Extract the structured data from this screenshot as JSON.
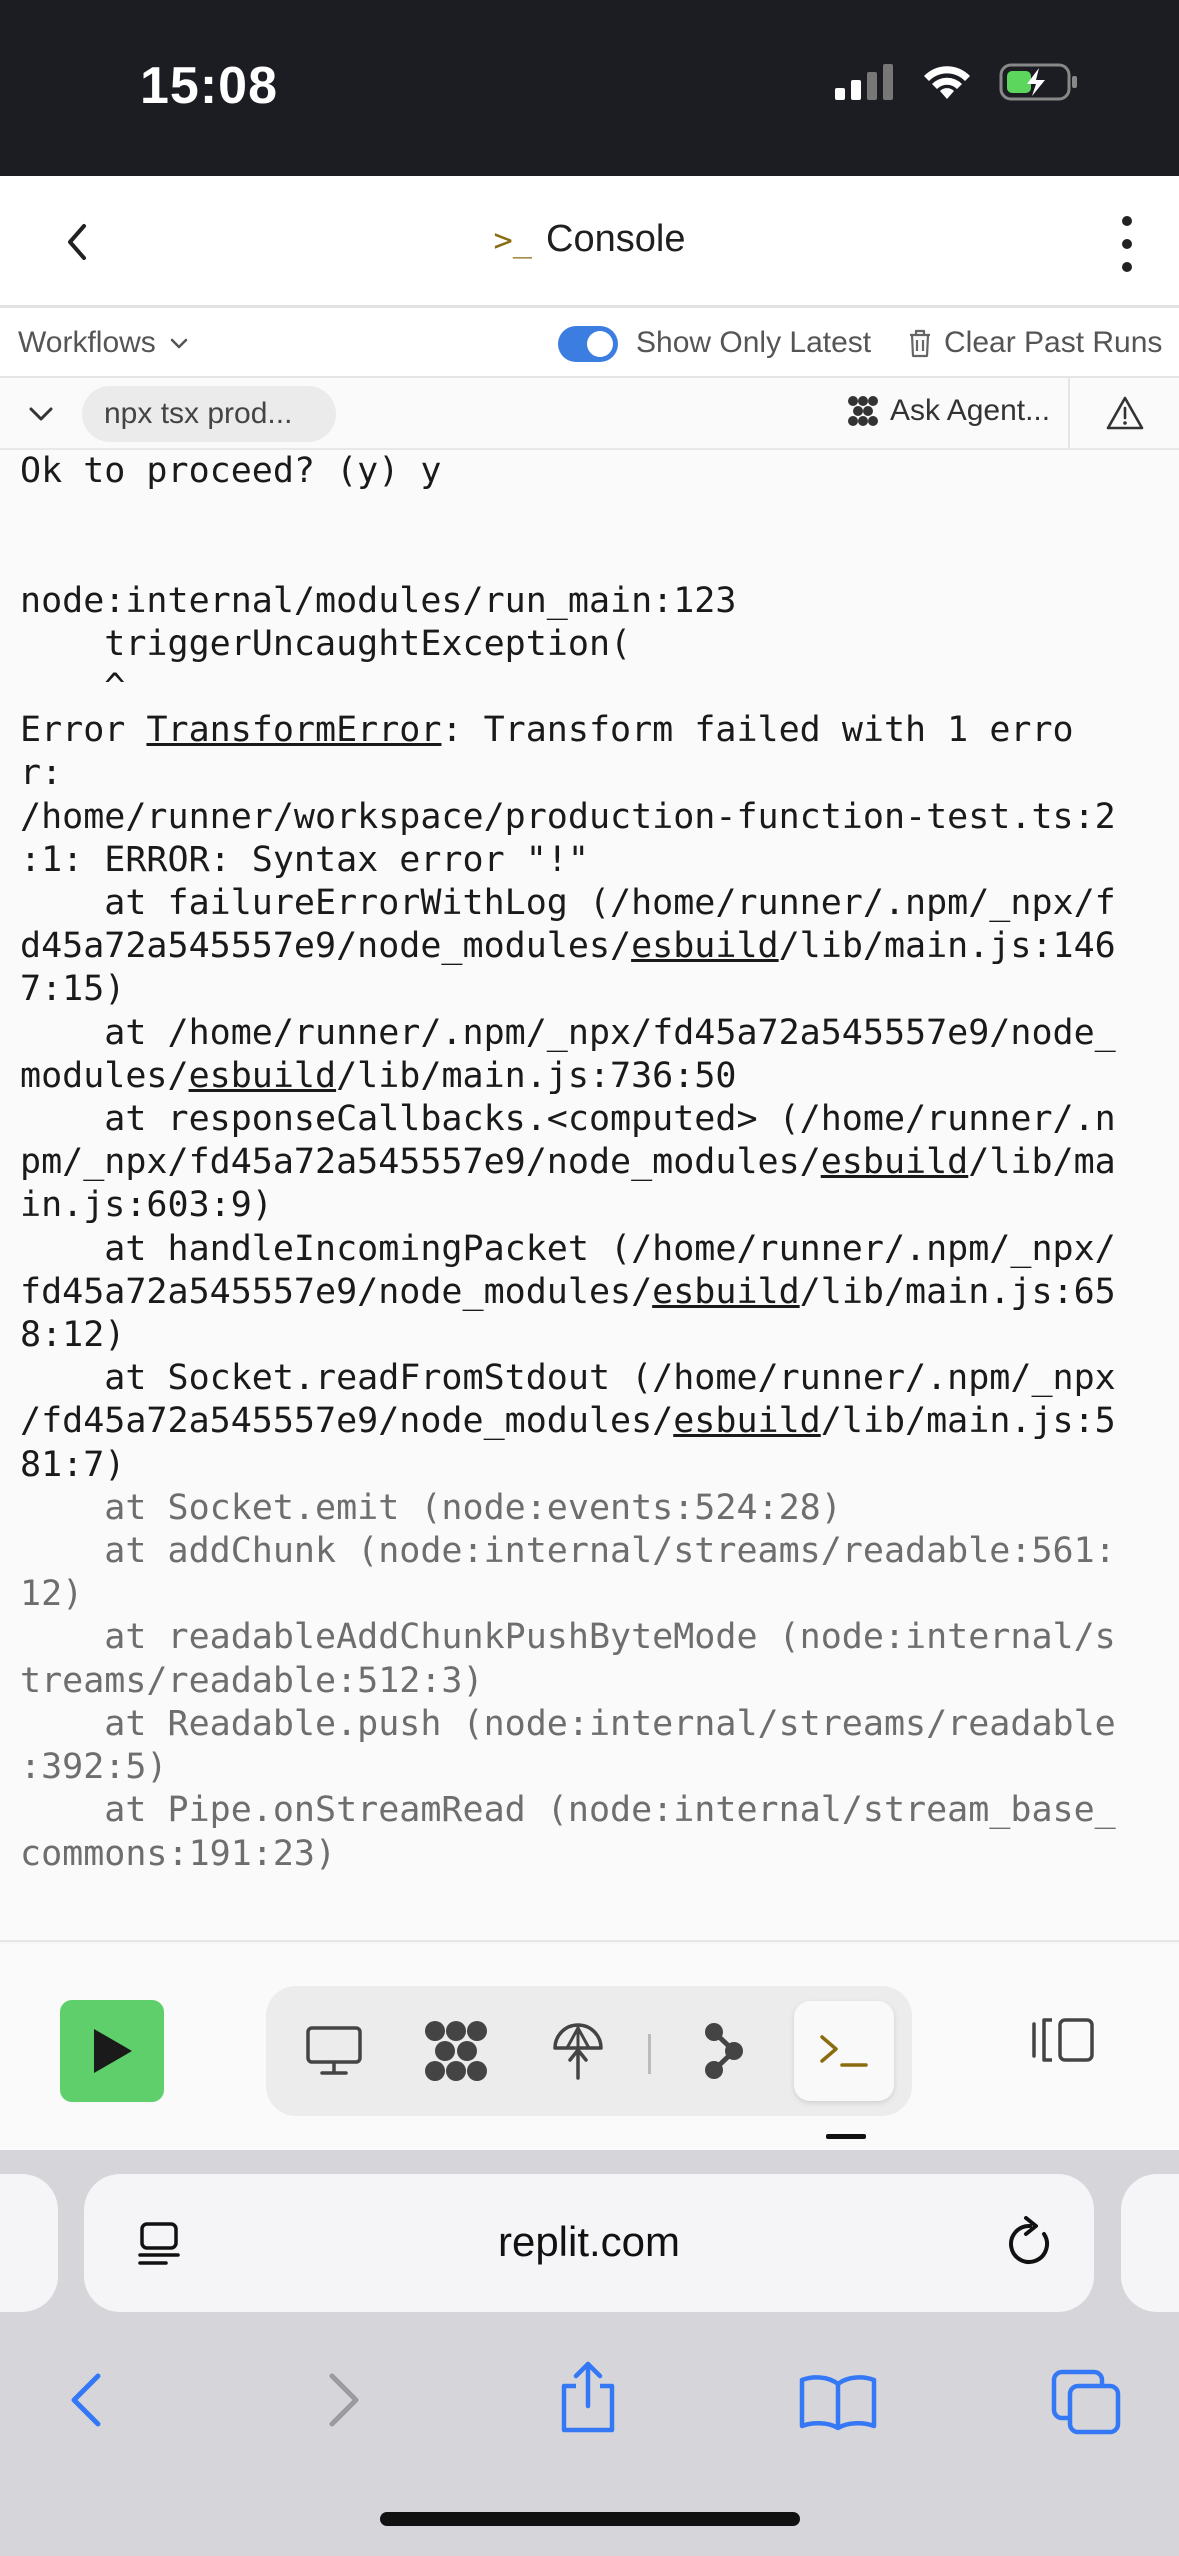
{
  "status": {
    "time": "15:08"
  },
  "header": {
    "prompt": ">_",
    "title": "Console"
  },
  "workflows": {
    "label": "Workflows",
    "show_only_latest": "Show Only Latest",
    "toggle_on": true,
    "clear_past_runs": "Clear Past Runs"
  },
  "commandbar": {
    "command": "npx tsx prod...",
    "ask_agent": "Ask Agent..."
  },
  "console": {
    "lines": [
      {
        "text": "Ok to proceed? (y) y",
        "style": "normal"
      },
      {
        "text": "",
        "style": "normal"
      },
      {
        "text": "",
        "style": "normal"
      },
      {
        "text": "node:internal/modules/run_main:123",
        "style": "normal"
      },
      {
        "text": "    triggerUncaughtException(",
        "style": "normal"
      },
      {
        "text": "    ^",
        "style": "normal"
      },
      {
        "text": "Error [TransformError]: Transform failed with 1 erro",
        "style": "normal"
      },
      {
        "text": "r:",
        "style": "normal"
      },
      {
        "text": "/home/runner/workspace/production-function-test.ts:2",
        "style": "normal"
      },
      {
        "text": ":1: ERROR: Syntax error \"!\"",
        "style": "normal"
      },
      {
        "text": "    at failureErrorWithLog (/home/runner/.npm/_npx/f",
        "style": "normal"
      },
      {
        "text": "d45a72a545557e9/node_modules/[esbuild]/lib/main.js:146",
        "style": "normal"
      },
      {
        "text": "7:15)",
        "style": "normal"
      },
      {
        "text": "    at /home/runner/.npm/_npx/fd45a72a545557e9/node_",
        "style": "normal"
      },
      {
        "text": "modules/[esbuild]/lib/main.js:736:50",
        "style": "normal"
      },
      {
        "text": "    at responseCallbacks.<computed> (/home/runner/.n",
        "style": "normal"
      },
      {
        "text": "pm/_npx/fd45a72a545557e9/node_modules/[esbuild]/lib/ma",
        "style": "normal"
      },
      {
        "text": "in.js:603:9)",
        "style": "normal"
      },
      {
        "text": "    at handleIncomingPacket (/home/runner/.npm/_npx/",
        "style": "normal"
      },
      {
        "text": "fd45a72a545557e9/node_modules/[esbuild]/lib/main.js:65",
        "style": "normal"
      },
      {
        "text": "8:12)",
        "style": "normal"
      },
      {
        "text": "    at Socket.readFromStdout (/home/runner/.npm/_npx",
        "style": "normal"
      },
      {
        "text": "/fd45a72a545557e9/node_modules/[esbuild]/lib/main.js:5",
        "style": "normal"
      },
      {
        "text": "81:7)",
        "style": "normal"
      },
      {
        "text": "    at Socket.emit (node:events:524:28)",
        "style": "gray"
      },
      {
        "text": "    at addChunk (node:internal/streams/readable:561:",
        "style": "gray"
      },
      {
        "text": "12)",
        "style": "gray"
      },
      {
        "text": "    at readableAddChunkPushByteMode (node:internal/s",
        "style": "gray"
      },
      {
        "text": "treams/readable:512:3)",
        "style": "gray"
      },
      {
        "text": "    at Readable.push (node:internal/streams/readable",
        "style": "gray"
      },
      {
        "text": ":392:5)",
        "style": "gray"
      },
      {
        "text": "    at Pipe.onStreamRead (node:internal/stream_base_",
        "style": "gray"
      },
      {
        "text": "commons:191:23)",
        "style": "gray"
      }
    ]
  },
  "toolbar": {
    "tabs": [
      {
        "icon": "monitor-icon"
      },
      {
        "icon": "agent-icon"
      },
      {
        "icon": "deploy-icon"
      },
      {
        "icon": "git-icon"
      },
      {
        "icon": "console-icon",
        "label": ">_",
        "active": true
      }
    ]
  },
  "browser": {
    "url": "replit.com"
  },
  "colors": {
    "accent": "#3b7de0",
    "run": "#5fcf6b",
    "prompt": "#8a6d10",
    "safari_blue": "#3478f6"
  }
}
